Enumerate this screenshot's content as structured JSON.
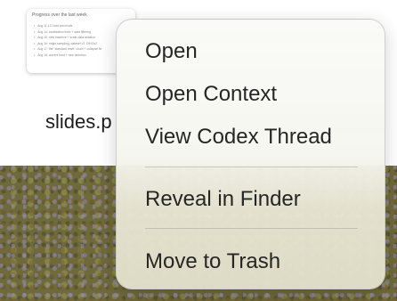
{
  "thumbnail": {
    "title": "Progress over the last week",
    "lines": [
      "Aug 11-13: load and evals",
      "Aug 14: localization fixes + data filtering",
      "Aug 15: new baseline + scale-data ablation",
      "Aug 16: origin sampling, dataset v2, DINOv2",
      "Aug 17: the \"standard reset\" chain + collapse fix",
      "Aug 18: current best + new direction"
    ]
  },
  "file": {
    "name": "slides.p"
  },
  "context_menu": {
    "items": [
      {
        "label": "Open"
      },
      {
        "label": "Open Context"
      },
      {
        "label": "View Codex Thread"
      },
      {
        "label": "Reveal in Finder"
      },
      {
        "label": "Move to Trash"
      }
    ]
  }
}
